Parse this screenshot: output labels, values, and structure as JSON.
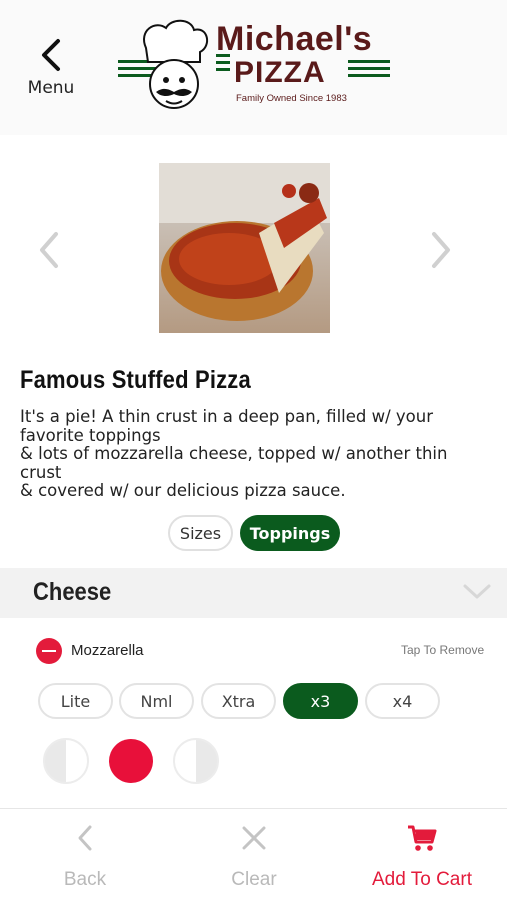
{
  "header": {
    "menu_label": "Menu",
    "logo_title": "Michael's",
    "logo_subtitle": "PIZZA",
    "logo_tagline": "Family Owned Since 1983"
  },
  "product": {
    "title": "Famous Stuffed Pizza",
    "description": "It's a pie! A thin crust in a deep pan, filled w/ your favorite toppings\n & lots of mozzarella cheese, topped w/ another thin crust\n& covered w/ our delicious pizza sauce."
  },
  "tabs": {
    "sizes": "Sizes",
    "toppings": "Toppings",
    "active": "toppings"
  },
  "section": {
    "title": "Cheese"
  },
  "topping": {
    "name": "Mozzarella",
    "tap_remove": "Tap To Remove",
    "amounts": [
      "Lite",
      "Nml",
      "Xtra",
      "x3",
      "x4"
    ],
    "selected_amount": "x3",
    "portion_selected": "whole"
  },
  "bottom_bar": {
    "back": "Back",
    "clear": "Clear",
    "add_to_cart": "Add To Cart"
  },
  "colors": {
    "brand_green": "#0b5b1e",
    "accent_red": "#e31b3b",
    "logo_brown": "#5a1a1a"
  }
}
